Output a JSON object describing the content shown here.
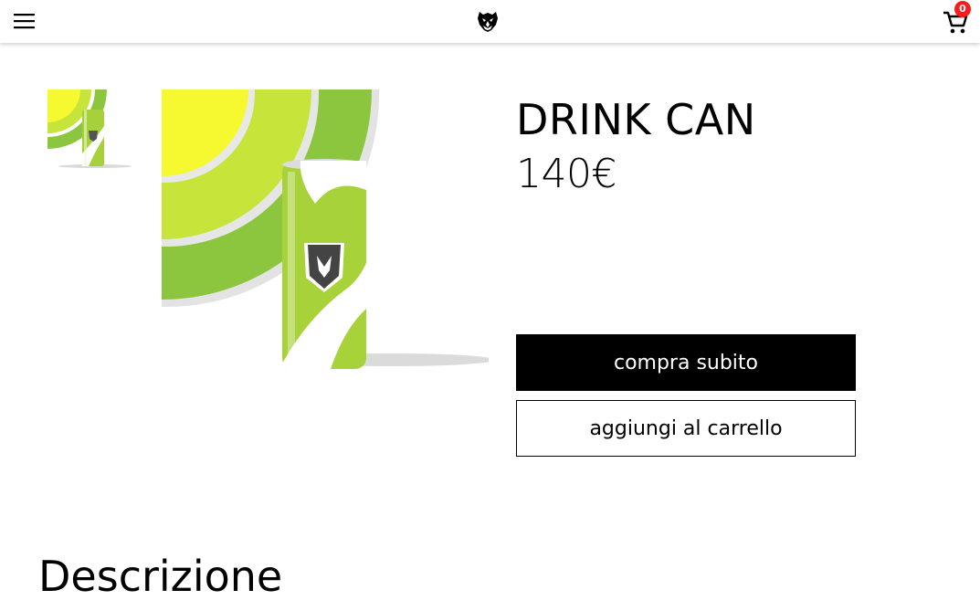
{
  "header": {
    "menu_icon": "hamburger-menu-icon",
    "logo_icon": "tiger-head-logo",
    "cart_icon": "shopping-cart-icon",
    "cart_count": "0"
  },
  "product": {
    "name": "DRINK CAN",
    "price": "140€",
    "buy_now_label": "compra subito",
    "add_to_cart_label": "aggiungi al carrello"
  },
  "description": {
    "heading": "Descrizione"
  },
  "colors": {
    "yellow": "#f7f930",
    "lime": "#c6e43a",
    "green": "#8cc63f",
    "badge": "#ff1b1b"
  }
}
